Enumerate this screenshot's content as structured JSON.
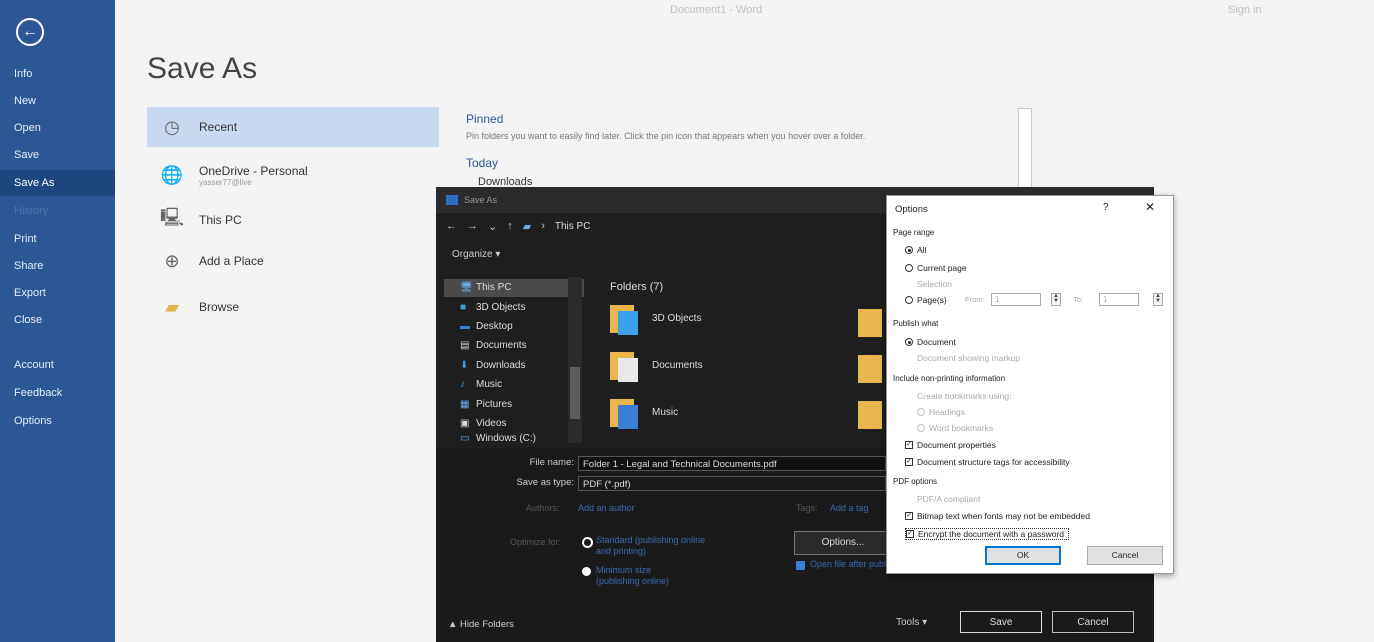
{
  "window": {
    "doc_title": "Document1 - Word",
    "account": "Sign in"
  },
  "sidebar": {
    "back_icon": "back-arrow-icon",
    "items": [
      {
        "label": "Info"
      },
      {
        "label": "New"
      },
      {
        "label": "Open"
      },
      {
        "label": "Save"
      },
      {
        "label": "Save As",
        "active": true
      },
      {
        "label": "History"
      },
      {
        "label": "Print"
      },
      {
        "label": "Share"
      },
      {
        "label": "Export"
      },
      {
        "label": "Close"
      },
      {
        "label": "Account"
      },
      {
        "label": "Feedback"
      },
      {
        "label": "Options"
      }
    ]
  },
  "main": {
    "title": "Save As",
    "locations": [
      {
        "label": "Recent",
        "icon": "clock-icon",
        "selected": true
      },
      {
        "label": "OneDrive - Personal",
        "sub": "yasser77@live",
        "icon": "globe-icon"
      },
      {
        "label": "This PC",
        "icon": "pc-icon"
      },
      {
        "label": "Add a Place",
        "icon": "add-place-icon"
      },
      {
        "label": "Browse",
        "icon": "folder-icon"
      }
    ],
    "pinned_title": "Pinned",
    "pinned_desc": "Pin folders you want to easily find later. Click the pin icon that appears when you hover over a folder.",
    "today_label": "Today",
    "today_folder": "Downloads"
  },
  "saveas_dialog": {
    "title": "Save As",
    "path": "This PC",
    "organize": "Organize ▾",
    "nav_items": [
      {
        "label": "This PC",
        "glyph": "🖥",
        "selected": true
      },
      {
        "label": "3D Objects",
        "glyph": "■"
      },
      {
        "label": "Desktop",
        "glyph": "▬"
      },
      {
        "label": "Documents",
        "glyph": "▤"
      },
      {
        "label": "Downloads",
        "glyph": "⬇"
      },
      {
        "label": "Music",
        "glyph": "♪"
      },
      {
        "label": "Pictures",
        "glyph": "▦"
      },
      {
        "label": "Videos",
        "glyph": "▣"
      },
      {
        "label": "Windows (C:)",
        "glyph": "▭"
      }
    ],
    "folders_header": "Folders (7)",
    "folders": [
      {
        "label": "3D Objects",
        "color": "#3aa0e8"
      },
      {
        "label": "Documents",
        "color": "#e8e8e8"
      },
      {
        "label": "Music",
        "color": "#3a7fd5"
      }
    ],
    "file_name_label": "File name:",
    "file_name": "Folder 1 - Legal and Technical Documents.pdf",
    "save_type_label": "Save as type:",
    "save_type": "PDF (*.pdf)",
    "authors_label": "Authors:",
    "authors": "Add an author",
    "tags_label": "Tags:",
    "tags": "Add a tag",
    "optimize_label": "Optimize for:",
    "opt1": "Standard (publishing online and printing)",
    "opt2": "Minimum size (publishing online)",
    "options_button": "Options...",
    "open_after": "Open file after publishing",
    "hide_folders": "Hide Folders",
    "tools": "Tools",
    "save": "Save",
    "cancel": "Cancel"
  },
  "options_dialog": {
    "title": "Options",
    "help": "?",
    "close": "✕",
    "page_range_header": "Page range",
    "all": "All",
    "current_page": "Current page",
    "selection": "Selection",
    "pages": "Page(s)",
    "from": "From:",
    "from_value": "1",
    "to": "To:",
    "to_value": "1",
    "publish_header": "Publish what",
    "document": "Document",
    "doc_markup": "Document showing markup",
    "nonprint_header": "Include non-printing information",
    "create_bookmarks": "Create bookmarks using:",
    "headings": "Headings",
    "word_bookmarks": "Word bookmarks",
    "doc_properties": "Document properties",
    "struct_tags": "Document structure tags for accessibility",
    "pdf_header": "PDF options",
    "pdfa": "PDF/A compliant",
    "bitmap_text": "Bitmap text when fonts may not be embedded",
    "encrypt": "Encrypt the document with a password",
    "ok": "OK",
    "cancel": "Cancel"
  }
}
